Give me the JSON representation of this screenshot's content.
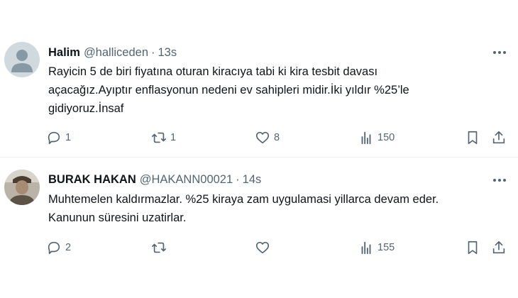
{
  "colors": {
    "text_primary": "#0f1419",
    "text_secondary": "#536471",
    "divider": "#eff3f4",
    "icon": "#536471"
  },
  "tweets": [
    {
      "author_name": "Halim",
      "handle": "@halliceden",
      "separator": "·",
      "time": "13s",
      "avatar": "default-avatar",
      "text_lines": [
        "Rayicin 5 de biri fiyatına oturan kiracıya tabi ki kira tesbit davası",
        "açacağız.Ayıptır enflasyonun nedeni ev sahipleri midir.İki yıldır %25’le",
        "gidiyoruz.İnsaf"
      ],
      "replies": "1",
      "retweets": "1",
      "likes": "8",
      "views": "150"
    },
    {
      "author_name": "BURAK HAKAN",
      "handle": "@HAKANN00021",
      "separator": "·",
      "time": "14s",
      "avatar": "profile-photo",
      "text_lines": [
        "Muhtemelen kaldırmazlar. %25 kiraya zam uygulamasi yillarca devam eder.",
        "Kanunun süresini uzatirlar."
      ],
      "replies": "2",
      "retweets": "",
      "likes": "",
      "views": "155"
    }
  ]
}
